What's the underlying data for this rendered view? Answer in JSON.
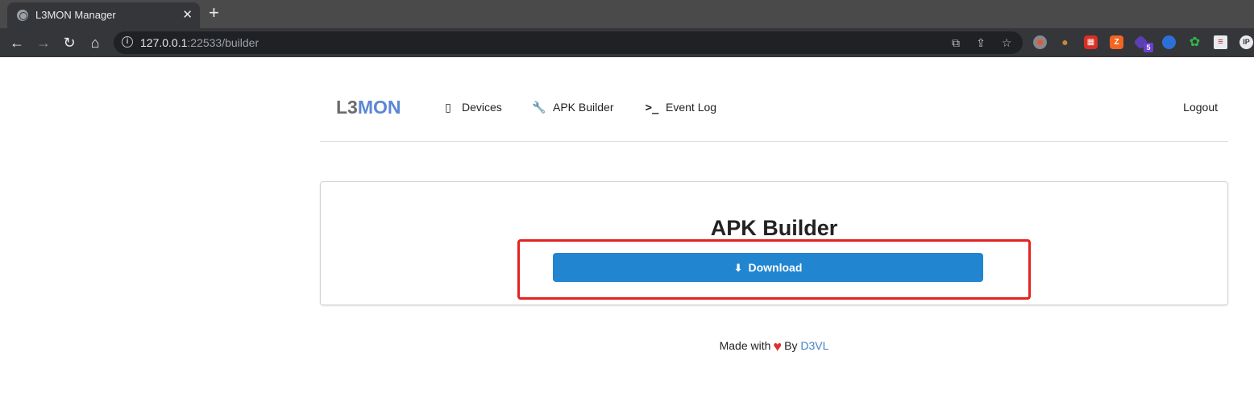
{
  "browser": {
    "tab_title": "L3MON Manager",
    "tab_close": "✕",
    "new_tab": "+",
    "url_host": "127.0.0.1",
    "url_rest": ":22533/builder",
    "extension_badge": "5",
    "ip_extension_label": "IP"
  },
  "navbar": {
    "brand_prefix": "L3",
    "brand_suffix": "MON",
    "items": [
      {
        "label": "Devices",
        "icon": "mobile-phone-icon"
      },
      {
        "label": "APK Builder",
        "icon": "wrench-icon"
      },
      {
        "label": "Event Log",
        "icon": "terminal-icon"
      }
    ],
    "logout": "Logout"
  },
  "builder": {
    "title": "APK Builder",
    "download_label": "Download"
  },
  "footer": {
    "made_with": "Made with",
    "by": "By",
    "author": "D3VL"
  },
  "colors": {
    "accent": "#5c86d6",
    "button": "#2185d0",
    "highlight": "#e52222",
    "heart": "#e02d2d"
  }
}
